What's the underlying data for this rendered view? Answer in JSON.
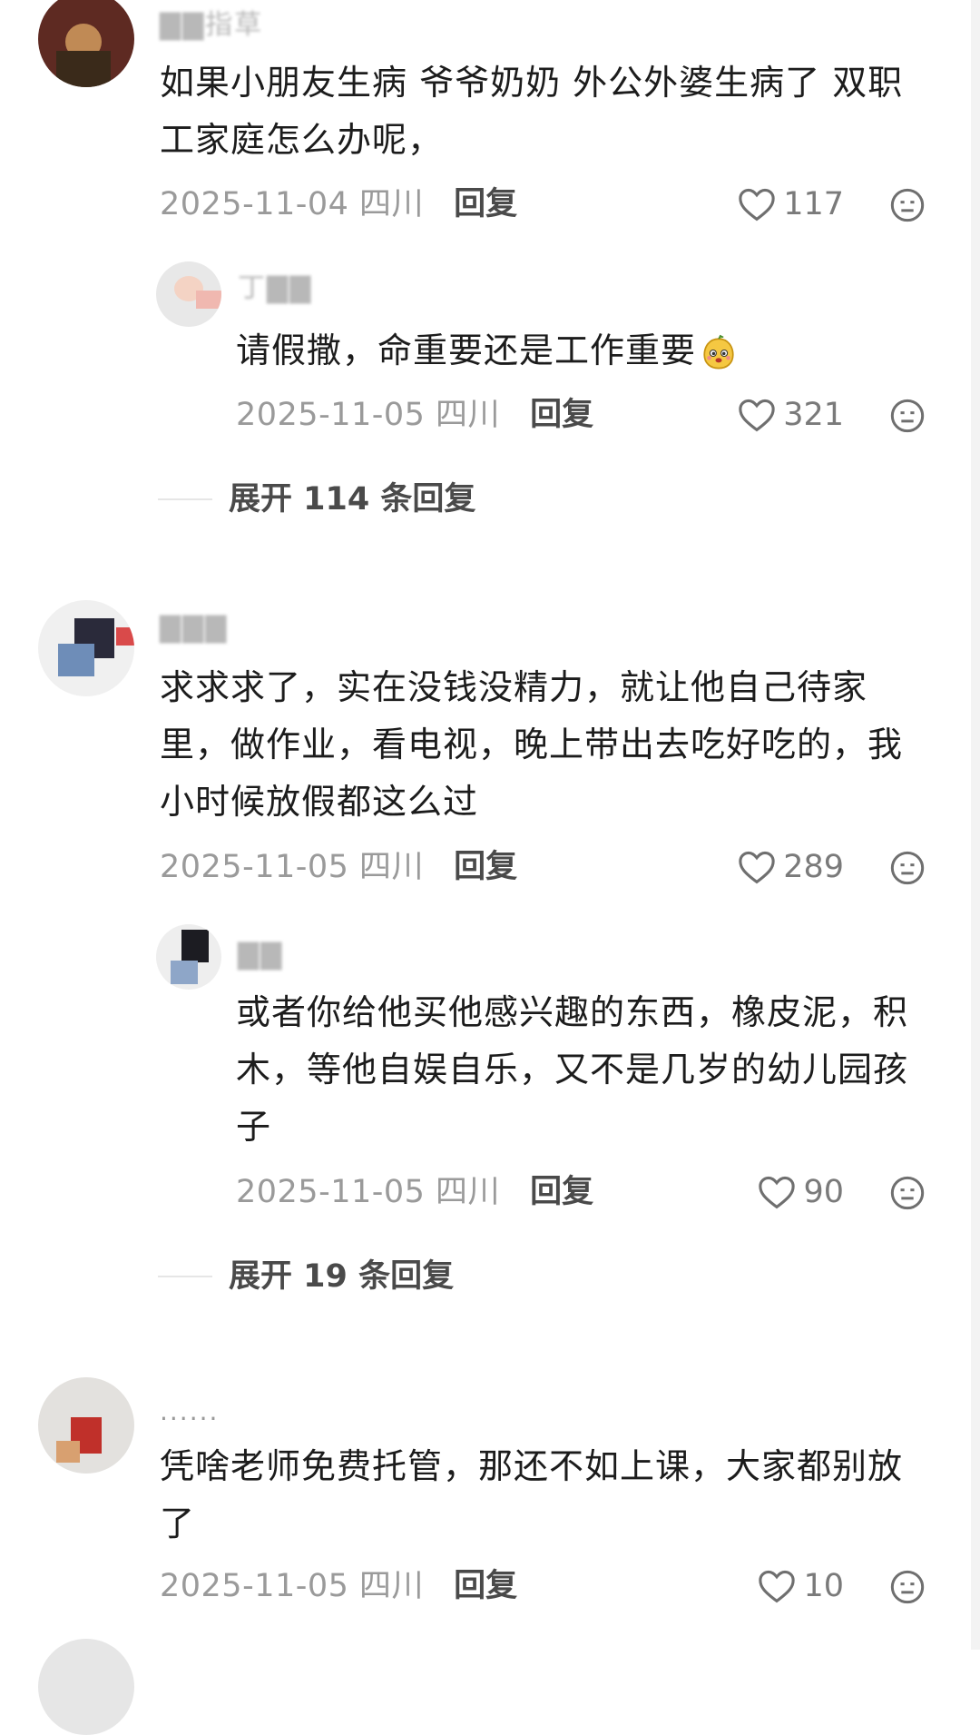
{
  "comments": [
    {
      "username": "▇▇指草",
      "text_lines": [
        "如果小朋友生病 爷爷奶奶 外公外婆生病了 双职",
        "工家庭怎么办呢，"
      ],
      "date": "2025-11-04 四川",
      "reply_label": "回复",
      "likes": "117",
      "replies": [
        {
          "username": "丁▇▇",
          "text_lines": [
            "请假撒，命重要还是工作重要"
          ],
          "emoji": "lemon-face-emoji",
          "date": "2025-11-05 四川",
          "reply_label": "回复",
          "likes": "321"
        }
      ],
      "expand_label": "展开 114 条回复"
    },
    {
      "username": "▇▇▇",
      "text_lines": [
        "求求求了，实在没钱没精力，就让他自己待家",
        "里，做作业，看电视，晚上带出去吃好吃的，我",
        "小时候放假都这么过"
      ],
      "date": "2025-11-05 四川",
      "reply_label": "回复",
      "likes": "289",
      "replies": [
        {
          "username": "▇▇",
          "text_lines": [
            "或者你给他买他感兴趣的东西，橡皮泥，积",
            "木，等他自娱自乐，又不是几岁的幼儿园孩",
            "子"
          ],
          "date": "2025-11-05 四川",
          "reply_label": "回复",
          "likes": "90"
        }
      ],
      "expand_label": "展开 19 条回复"
    },
    {
      "username": "......",
      "text_lines": [
        "凭啥老师免费托管，那还不如上课，大家都别放",
        "了"
      ],
      "date": "2025-11-05 四川",
      "reply_label": "回复",
      "likes": "10"
    }
  ],
  "colors": {
    "text": "#1c1c1c",
    "meta": "#9a9a9a",
    "accent": "#4a4a4a"
  },
  "icons": {
    "like": "heart-outline-icon",
    "dislike": "neutral-face-icon"
  }
}
